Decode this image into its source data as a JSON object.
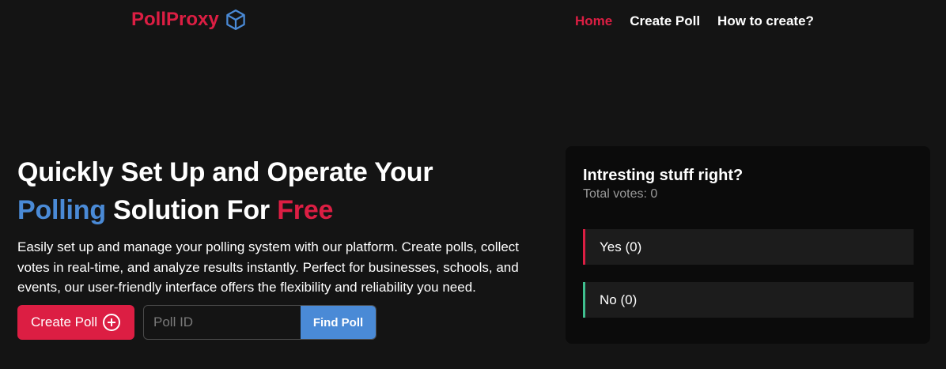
{
  "brand": {
    "name": "PollProxy",
    "color": "#dc1e43",
    "icon": "cube-icon",
    "icon_color": "#4a8ad6"
  },
  "nav": [
    {
      "label": "Home",
      "active": true
    },
    {
      "label": "Create Poll",
      "active": false
    },
    {
      "label": "How to create?",
      "active": false
    }
  ],
  "hero": {
    "headline_part1": "Quickly Set Up and Operate Your",
    "headline_highlight_blue": "Polling",
    "headline_part2": " Solution For ",
    "headline_highlight_red": "Free",
    "description": "Easily set up and manage your polling system with our platform. Create polls, collect votes in real-time, and analyze results instantly. Perfect for businesses, schools, and events, our user-friendly interface offers the flexibility and reliability you need."
  },
  "actions": {
    "create_label": "Create Poll",
    "create_icon": "plus-circle-icon",
    "poll_id_placeholder": "Poll ID",
    "poll_id_value": "",
    "find_label": "Find Poll"
  },
  "poll_card": {
    "question": "Intresting stuff right?",
    "total_votes": "Total votes: 0",
    "options": [
      {
        "label": "Yes (0)",
        "color": "#dc1e43"
      },
      {
        "label": "No (0)",
        "color": "#3fbf8f"
      }
    ]
  },
  "colors": {
    "accent_red": "#dc1e43",
    "accent_blue": "#4a8ad6",
    "background": "#141414",
    "card": "#0b0b0b"
  }
}
